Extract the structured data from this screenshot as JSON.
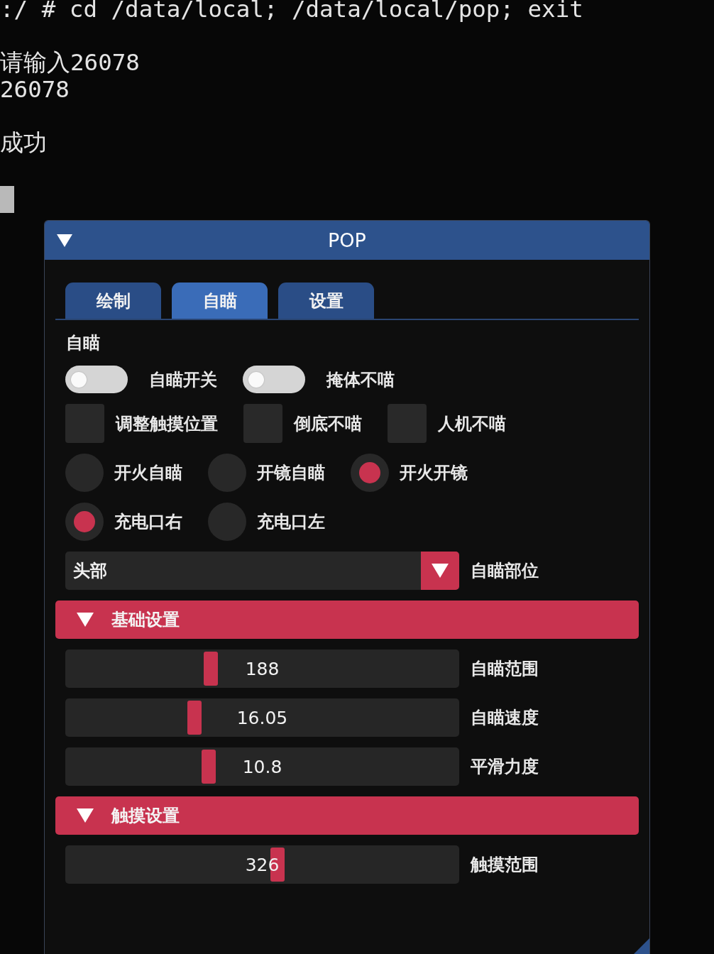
{
  "terminal": {
    "blocks": [
      [
        ":/ # cd /data/local; /data/local/pop; exit"
      ],
      [
        "请输入26078",
        "26078"
      ],
      [
        "成功"
      ]
    ],
    "cursor_visible": true
  },
  "window": {
    "title": "POP",
    "expanded": true
  },
  "tabs": [
    {
      "label": "绘制",
      "selected": false
    },
    {
      "label": "自瞄",
      "selected": true
    },
    {
      "label": "设置",
      "selected": false
    }
  ],
  "section_label": "自瞄",
  "toggles": [
    {
      "label": "自瞄开关",
      "on": false
    },
    {
      "label": "掩体不喵",
      "on": false
    }
  ],
  "checkboxes": [
    {
      "label": "调整触摸位置",
      "checked": false
    },
    {
      "label": "倒底不喵",
      "checked": false
    },
    {
      "label": "人机不喵",
      "checked": false
    }
  ],
  "radio_groups": [
    {
      "options": [
        {
          "label": "开火自瞄",
          "selected": false
        },
        {
          "label": "开镜自瞄",
          "selected": false
        },
        {
          "label": "开火开镜",
          "selected": true
        }
      ]
    },
    {
      "options": [
        {
          "label": "充电口右",
          "selected": true
        },
        {
          "label": "充电口左",
          "selected": false
        }
      ]
    }
  ],
  "dropdown": {
    "value": "头部",
    "label": "自瞄部位"
  },
  "sections": [
    {
      "title": "基础设置",
      "expanded": true,
      "sliders": [
        {
          "value": "188",
          "level": 0.363,
          "label": "自瞄范围"
        },
        {
          "value": "16.05",
          "level": 0.319,
          "label": "自瞄速度"
        },
        {
          "value": "10.8",
          "level": 0.357,
          "label": "平滑力度"
        }
      ]
    },
    {
      "title": "触摸设置",
      "expanded": true,
      "sliders": [
        {
          "value": "326",
          "level": 0.541,
          "label": "触摸范围"
        }
      ]
    }
  ]
}
